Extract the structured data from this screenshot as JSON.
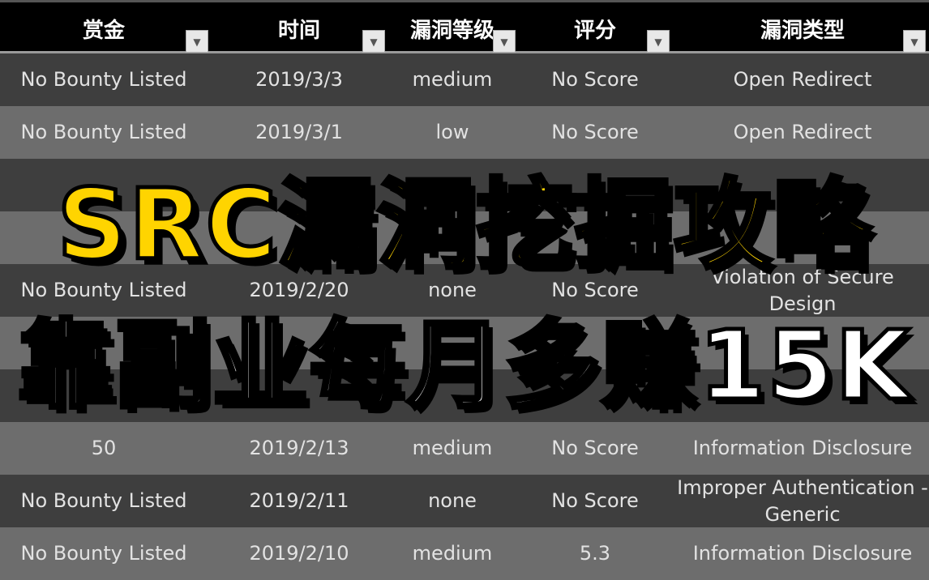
{
  "columns": [
    "赏金",
    "时间",
    "漏洞等级",
    "评分",
    "漏洞类型"
  ],
  "rows": [
    {
      "shade": "dark",
      "cells": [
        "No Bounty Listed",
        "2019/3/3",
        "medium",
        "No Score",
        "Open Redirect"
      ]
    },
    {
      "shade": "light",
      "cells": [
        "No Bounty Listed",
        "2019/3/1",
        "low",
        "No Score",
        "Open Redirect"
      ]
    },
    {
      "shade": "dark",
      "cells": [
        "",
        "",
        "",
        "",
        ""
      ]
    },
    {
      "shade": "light",
      "cells": [
        "",
        "",
        "",
        "",
        ""
      ]
    },
    {
      "shade": "dark",
      "cells": [
        "No Bounty Listed",
        "2019/2/20",
        "none",
        "No Score",
        "Violation of Secure Design"
      ]
    },
    {
      "shade": "light",
      "cells": [
        "",
        "",
        "",
        "",
        ""
      ]
    },
    {
      "shade": "dark",
      "cells": [
        "",
        "",
        "",
        "",
        ""
      ]
    },
    {
      "shade": "light",
      "cells": [
        "50",
        "2019/2/13",
        "medium",
        "No Score",
        "Information Disclosure"
      ]
    },
    {
      "shade": "dark",
      "cells": [
        "No Bounty Listed",
        "2019/2/11",
        "none",
        "No Score",
        "Improper Authentication - Generic"
      ]
    },
    {
      "shade": "light",
      "cells": [
        "No Bounty Listed",
        "2019/2/10",
        "medium",
        "5.3",
        "Information Disclosure"
      ]
    }
  ],
  "overlay": {
    "title": "SRC漏洞挖掘攻略",
    "subtitle": "靠副业每月多赚15K"
  },
  "colors": {
    "title": "#ffd400",
    "subtitle": "#ffffff",
    "header_bg": "#000000"
  },
  "icons": {
    "filter": "dropdown-filter-icon"
  }
}
